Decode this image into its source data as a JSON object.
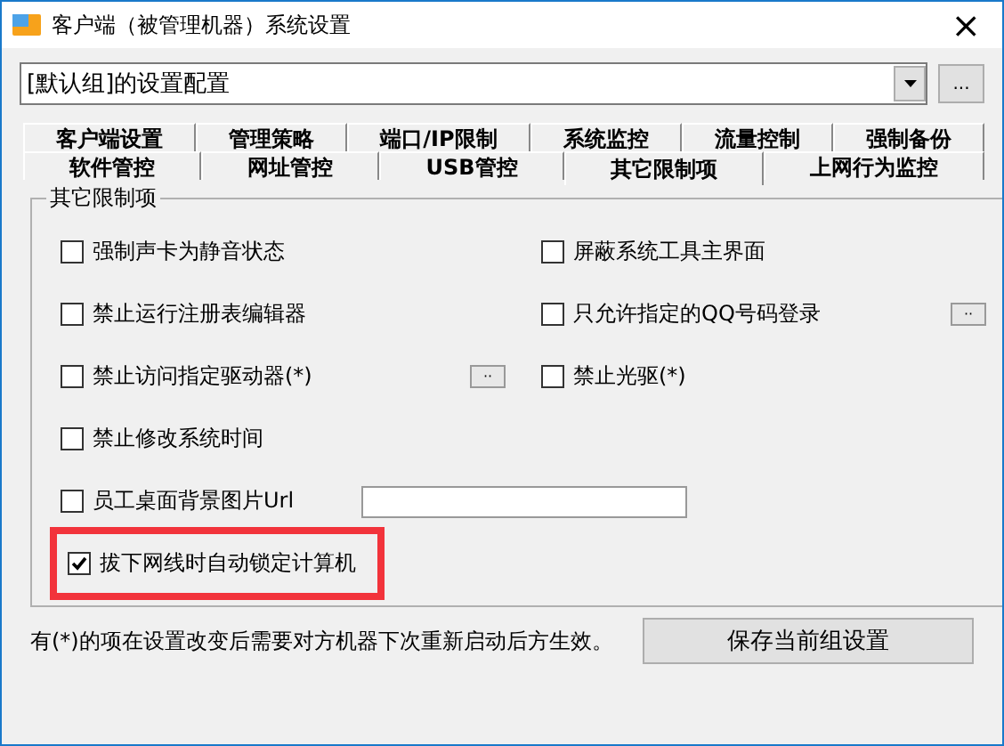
{
  "window": {
    "title": "客户端（被管理机器）系统设置",
    "close": "×"
  },
  "profile": {
    "value": "[默认组]的设置配置",
    "more": "..."
  },
  "tab_rows": [
    {
      "tabs": [
        {
          "label": "客户端设置",
          "selected": false
        },
        {
          "label": "管理策略",
          "selected": false
        },
        {
          "label": "端口/IP限制",
          "selected": false
        },
        {
          "label": "系统监控",
          "selected": false
        },
        {
          "label": "流量控制",
          "selected": false
        },
        {
          "label": "强制备份",
          "selected": false
        }
      ]
    },
    {
      "tabs": [
        {
          "label": "软件管控",
          "selected": false
        },
        {
          "label": "网址管控",
          "selected": false
        },
        {
          "label": "USB管控",
          "selected": false
        },
        {
          "label": "其它限制项",
          "selected": true
        },
        {
          "label": "上网行为监控",
          "selected": false
        }
      ]
    }
  ],
  "group": {
    "title": "其它限制项",
    "rows": [
      {
        "items": [
          {
            "kind": "checkbox",
            "label": "强制声卡为静音状态",
            "checked": false,
            "highlighted": false
          },
          {
            "kind": "checkbox",
            "label": "屏蔽系统工具主界面",
            "checked": false,
            "highlighted": false
          }
        ]
      },
      {
        "items": [
          {
            "kind": "checkbox",
            "label": "禁止运行注册表编辑器",
            "checked": false,
            "highlighted": false
          },
          {
            "kind": "with-button",
            "label": "只允许指定的QQ号码登录",
            "checked": false,
            "highlighted": false,
            "button": "··"
          }
        ]
      },
      {
        "items": [
          {
            "kind": "with-button",
            "label": "禁止访问指定驱动器(*)",
            "checked": false,
            "highlighted": false,
            "button": "··"
          },
          {
            "kind": "checkbox",
            "label": "禁止光驱(*)",
            "checked": false,
            "highlighted": false
          }
        ]
      },
      {
        "items": [
          {
            "kind": "checkbox",
            "label": "禁止修改系统时间",
            "checked": false,
            "highlighted": false
          }
        ]
      },
      {
        "items": [
          {
            "kind": "with-field",
            "label": "员工桌面背景图片Url",
            "checked": false,
            "highlighted": false
          }
        ]
      },
      {
        "items": [
          {
            "kind": "checkbox",
            "label": "拔下网线时自动锁定计算机",
            "checked": true,
            "highlighted": true
          }
        ]
      }
    ]
  },
  "note": "有(*)的项在设置改变后需要对方机器下次重新启动后方生效。",
  "save_button": "保存当前组设置"
}
